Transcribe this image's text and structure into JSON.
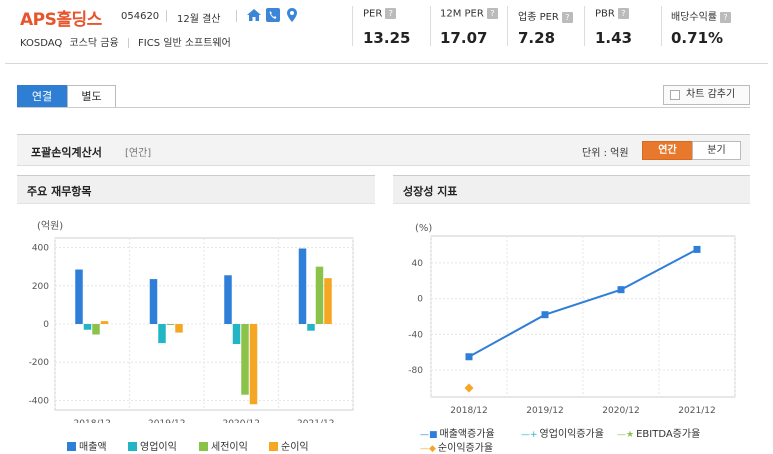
{
  "header": {
    "company_name": "APS홀딩스",
    "stock_code": "054620",
    "fiscal_month": "12월 결산",
    "market": "KOSDAQ",
    "market_sector": "코스닥 금융",
    "fics_sector": "FICS 일반 소프트웨어",
    "icons": [
      "home-icon",
      "phone-icon",
      "location-icon"
    ],
    "metrics": [
      {
        "label": "PER",
        "value": "13.25"
      },
      {
        "label": "12M PER",
        "value": "17.07"
      },
      {
        "label": "업종 PER",
        "value": "7.28"
      },
      {
        "label": "PBR",
        "value": "1.43"
      },
      {
        "label": "배당수익률",
        "value": "0.71%"
      }
    ],
    "help_glyph": "?"
  },
  "tabs": [
    {
      "label": "연결",
      "active": true
    },
    {
      "label": "별도",
      "active": false
    }
  ],
  "hide_chart_label": "차트 감추기",
  "section": {
    "title": "포괄손익계산서",
    "subtitle": "[연간]",
    "unit_label": "단위 : 억원",
    "toggles": [
      {
        "label": "연간",
        "active": true
      },
      {
        "label": "분기",
        "active": false
      }
    ]
  },
  "panels": {
    "left_title": "주요 재무항목",
    "right_title": "성장성 지표"
  },
  "chart_data": [
    {
      "type": "bar",
      "ylabel": "(억원)",
      "ylim": [
        -450,
        450
      ],
      "yticks": [
        400,
        200,
        0,
        -200,
        -400
      ],
      "categories": [
        "2018/12",
        "2019/12",
        "2020/12",
        "2021/12"
      ],
      "series": [
        {
          "name": "매출액",
          "color": "#2f7ed8",
          "values": [
            285,
            235,
            255,
            395
          ]
        },
        {
          "name": "영업이익",
          "color": "#23b5c6",
          "values": [
            -30,
            -100,
            -105,
            -35
          ]
        },
        {
          "name": "세전이익",
          "color": "#8bc34a",
          "values": [
            -55,
            -5,
            -370,
            300
          ]
        },
        {
          "name": "순이익",
          "color": "#f5a623",
          "values": [
            15,
            -45,
            -420,
            240
          ]
        }
      ],
      "grid": true,
      "legend": "bottom"
    },
    {
      "type": "line",
      "ylabel": "(%)",
      "ylim": [
        -110,
        70
      ],
      "yticks": [
        40,
        0,
        -40,
        -80
      ],
      "categories": [
        "2018/12",
        "2019/12",
        "2020/12",
        "2021/12"
      ],
      "series": [
        {
          "name": "매출액증가율",
          "color": "#2f7ed8",
          "marker": "square",
          "values": [
            -65,
            -18,
            10,
            55
          ]
        },
        {
          "name": "영업이익증가율",
          "color": "#23b5c6",
          "marker": "cross",
          "values": [
            null,
            null,
            null,
            null
          ]
        },
        {
          "name": "EBITDA증가율",
          "color": "#8bc34a",
          "marker": "star",
          "values": [
            null,
            null,
            null,
            null
          ]
        },
        {
          "name": "순이익증가율",
          "color": "#f5a623",
          "marker": "diamond",
          "values": [
            -100,
            null,
            null,
            null
          ]
        }
      ],
      "grid": true,
      "legend": "bottom"
    }
  ]
}
